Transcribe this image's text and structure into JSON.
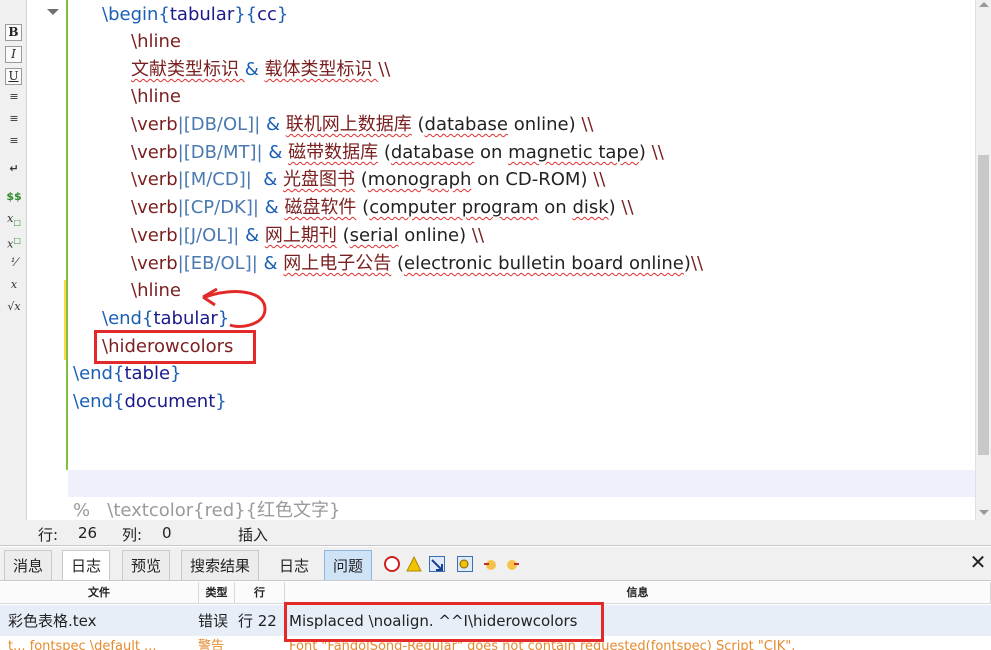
{
  "toolbar": {
    "bold": "B",
    "italic": "I",
    "underline": "U",
    "math_inline": "$$",
    "sub": "x",
    "sup": "x",
    "frac": "x",
    "sqrt": "√x"
  },
  "editor": {
    "lines": [
      {
        "segments": [
          {
            "t": "\\begin",
            "c": "cmd"
          },
          {
            "t": "{",
            "c": "brace"
          },
          {
            "t": "tabular",
            "c": "arg"
          },
          {
            "t": "}{",
            "c": "brace"
          },
          {
            "t": "cc",
            "c": "arg"
          },
          {
            "t": "}",
            "c": "brace"
          }
        ]
      },
      {
        "segments": [
          {
            "t": "\\hline",
            "c": "cmd2"
          }
        ]
      },
      {
        "segments": [
          {
            "t": "文献类型标识 ",
            "c": "cjk sq"
          },
          {
            "t": "& ",
            "c": "amp"
          },
          {
            "t": "载体类型标识 ",
            "c": "cjk sq"
          },
          {
            "t": "\\\\",
            "c": "cmd2"
          }
        ]
      },
      {
        "segments": [
          {
            "t": "\\hline",
            "c": "cmd2"
          }
        ]
      },
      {
        "segments": [
          {
            "t": "\\verb",
            "c": "cmd2"
          },
          {
            "t": "|[DB/OL]|",
            "c": "verbtext"
          },
          {
            "t": " & ",
            "c": "amp"
          },
          {
            "t": "联机网上数据库",
            "c": "cjk sq"
          },
          {
            "t": " (",
            "c": "plain"
          },
          {
            "t": "database",
            "c": "plain sq"
          },
          {
            "t": " online) ",
            "c": "plain"
          },
          {
            "t": "\\\\",
            "c": "cmd2"
          }
        ]
      },
      {
        "segments": [
          {
            "t": "\\verb",
            "c": "cmd2"
          },
          {
            "t": "|[DB/MT]|",
            "c": "verbtext"
          },
          {
            "t": " & ",
            "c": "amp"
          },
          {
            "t": "磁带数据库",
            "c": "cjk sq"
          },
          {
            "t": " (",
            "c": "plain"
          },
          {
            "t": "database",
            "c": "plain sq"
          },
          {
            "t": " on ",
            "c": "plain"
          },
          {
            "t": "magnetic tape",
            "c": "plain sq"
          },
          {
            "t": ") ",
            "c": "plain"
          },
          {
            "t": "\\\\",
            "c": "cmd2"
          }
        ]
      },
      {
        "segments": [
          {
            "t": "\\verb",
            "c": "cmd2"
          },
          {
            "t": "|[M/CD]|",
            "c": "verbtext"
          },
          {
            "t": "  & ",
            "c": "amp"
          },
          {
            "t": "光盘图书",
            "c": "cjk sq"
          },
          {
            "t": " (",
            "c": "plain"
          },
          {
            "t": "monograph",
            "c": "plain sq"
          },
          {
            "t": " on CD-ROM) ",
            "c": "plain"
          },
          {
            "t": "\\\\",
            "c": "cmd2"
          }
        ]
      },
      {
        "segments": [
          {
            "t": "\\verb",
            "c": "cmd2"
          },
          {
            "t": "|[CP/DK]|",
            "c": "verbtext"
          },
          {
            "t": " & ",
            "c": "amp"
          },
          {
            "t": "磁盘软件",
            "c": "cjk sq"
          },
          {
            "t": " (",
            "c": "plain"
          },
          {
            "t": "computer program",
            "c": "plain sq"
          },
          {
            "t": " on ",
            "c": "plain"
          },
          {
            "t": "disk",
            "c": "plain sq"
          },
          {
            "t": ") ",
            "c": "plain"
          },
          {
            "t": "\\\\",
            "c": "cmd2"
          }
        ]
      },
      {
        "segments": [
          {
            "t": "\\verb",
            "c": "cmd2"
          },
          {
            "t": "|[J/OL]|",
            "c": "verbtext"
          },
          {
            "t": " & ",
            "c": "amp"
          },
          {
            "t": "网上期刊",
            "c": "cjk sq"
          },
          {
            "t": " (",
            "c": "plain"
          },
          {
            "t": "serial",
            "c": "plain sq"
          },
          {
            "t": " online) ",
            "c": "plain"
          },
          {
            "t": "\\\\",
            "c": "cmd2"
          }
        ]
      },
      {
        "segments": [
          {
            "t": "\\verb",
            "c": "cmd2"
          },
          {
            "t": "|[EB/OL]|",
            "c": "verbtext"
          },
          {
            "t": " & ",
            "c": "amp"
          },
          {
            "t": "网上电子公告",
            "c": "cjk sq"
          },
          {
            "t": " (",
            "c": "plain"
          },
          {
            "t": "electronic bulletin board online",
            "c": "plain sq"
          },
          {
            "t": ")",
            "c": "plain"
          },
          {
            "t": "\\\\",
            "c": "cmd2"
          }
        ]
      },
      {
        "segments": [
          {
            "t": "\\hline",
            "c": "cmd2"
          }
        ]
      },
      {
        "segments": [
          {
            "t": "\\end",
            "c": "cmd"
          },
          {
            "t": "{",
            "c": "brace"
          },
          {
            "t": "tabular",
            "c": "arg"
          },
          {
            "t": "}",
            "c": "brace"
          }
        ]
      },
      {
        "segments": [
          {
            "t": "\\hiderowcolors",
            "c": "cmd2"
          }
        ]
      },
      {
        "segments": [
          {
            "t": "\\end",
            "c": "cmd"
          },
          {
            "t": "{",
            "c": "brace"
          },
          {
            "t": "table",
            "c": "arg"
          },
          {
            "t": "}",
            "c": "brace"
          }
        ]
      },
      {
        "segments": [
          {
            "t": "\\end",
            "c": "cmd"
          },
          {
            "t": "{",
            "c": "brace"
          },
          {
            "t": "document",
            "c": "arg"
          },
          {
            "t": "}",
            "c": "brace"
          }
        ]
      }
    ],
    "comment_line": "%   \\textcolor{red}{红色文字}"
  },
  "status": {
    "row_label": "行:",
    "row_value": "26",
    "col_label": "列:",
    "col_value": "0",
    "mode": "插入"
  },
  "panel": {
    "tabs": [
      "消息",
      "日志",
      "预览",
      "搜索结果",
      "日志",
      "问题"
    ],
    "active_tab": "日志",
    "close": "✕"
  },
  "log": {
    "headers": {
      "file": "文件",
      "type": "类型",
      "line": "行",
      "info": "信息"
    },
    "rows": [
      {
        "file": "彩色表格.tex",
        "type": "错误",
        "line": "行 22",
        "info": "Misplaced \\noalign. ^^I\\hiderowcolors"
      },
      {
        "file": "t... fontspec \\default ...",
        "type": "警告",
        "line": "",
        "info": "Font \"FandolSong-Regular\" does not contain requested(fontspec) Script \"CJK\"."
      }
    ]
  },
  "colors": {
    "annotation_red": "#e32a2a",
    "fold_green": "#7fc241",
    "latex_command_blue": "#1a5fb4",
    "latex_command_darkred": "#7a1f1f"
  }
}
